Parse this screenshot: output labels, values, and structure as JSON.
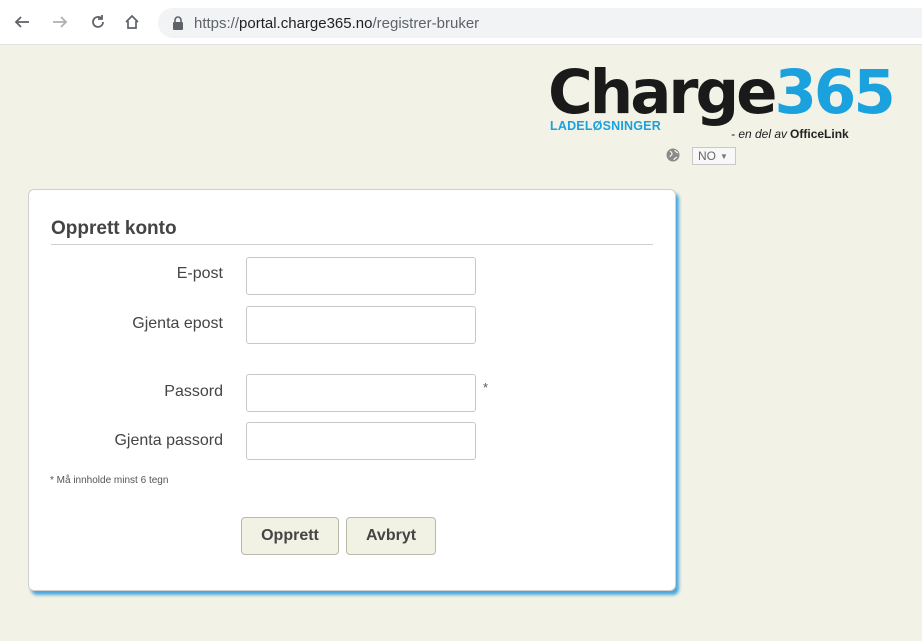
{
  "browser": {
    "url_scheme": "https://",
    "url_host": "portal.charge365.no",
    "url_path": "/registrer-bruker"
  },
  "logo": {
    "word_main": "Charge",
    "word_num": "365",
    "subtitle": "LADELØSNINGER",
    "tagline": "- en del av",
    "tagline_brand": "OfficeLink"
  },
  "language": {
    "selected": "NO"
  },
  "form": {
    "title": "Opprett konto",
    "fields": [
      {
        "label": "E-post",
        "value": ""
      },
      {
        "label": "Gjenta epost",
        "value": ""
      },
      {
        "label": "Passord",
        "value": ""
      },
      {
        "label": "Gjenta passord",
        "value": ""
      }
    ],
    "required_mark": "*",
    "note": "* Må innholde minst 6 tegn",
    "create_button": "Opprett",
    "cancel_button": "Avbryt"
  },
  "colors": {
    "accent": "#1ba1de",
    "page_bg": "#f2f3e6",
    "button_bg": "#f1f2e4"
  }
}
